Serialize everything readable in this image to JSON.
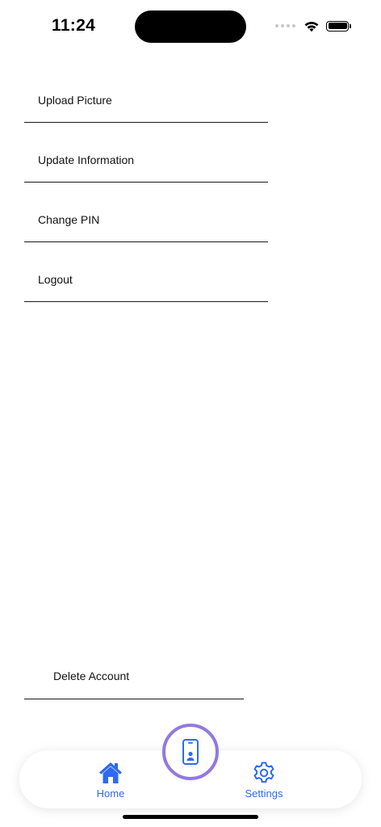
{
  "status_bar": {
    "time": "11:24"
  },
  "menu": {
    "items": [
      {
        "label": "Upload Picture"
      },
      {
        "label": "Update Information"
      },
      {
        "label": "Change PIN"
      },
      {
        "label": "Logout"
      }
    ],
    "delete_label": "Delete Account"
  },
  "tab_bar": {
    "home_label": "Home",
    "settings_label": "Settings",
    "center_icon": "phone-id-icon"
  },
  "colors": {
    "accent": "#2f6af0",
    "center_ring": "#9279e0"
  }
}
